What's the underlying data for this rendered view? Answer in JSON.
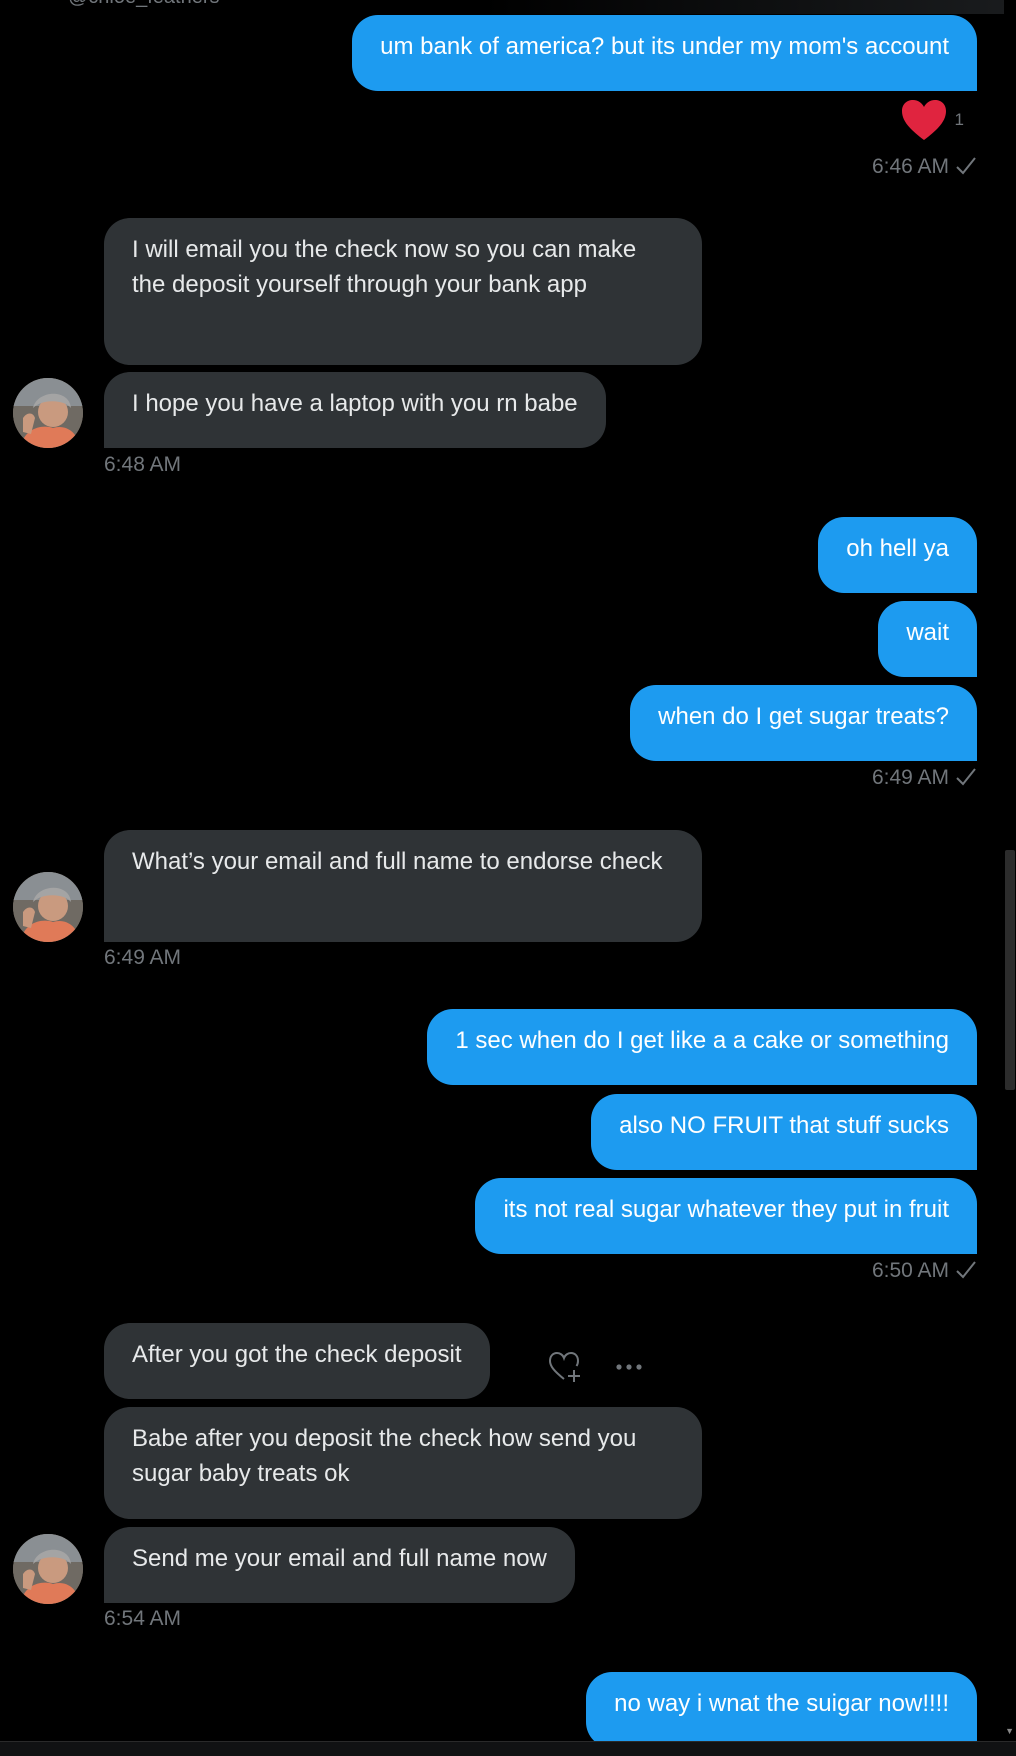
{
  "header": {
    "handle": "@chloe_feathers"
  },
  "messages": {
    "m1": {
      "text": "um bank of america? but its under my mom's account"
    },
    "m1_reaction_count": "1",
    "t1": "6:46 AM",
    "m2": {
      "text": "I will email you the check now so you can make the deposit yourself through your bank app"
    },
    "m3": {
      "text": "I hope you have a laptop with you rn babe"
    },
    "t2": "6:48 AM",
    "m4": {
      "text": "oh hell ya"
    },
    "m5": {
      "text": "wait"
    },
    "m6": {
      "text": "when do I get sugar treats?"
    },
    "t3": "6:49 AM",
    "m7": {
      "text": "What’s your email and full name to endorse check"
    },
    "t4": "6:49 AM",
    "m8": {
      "text": "1 sec when do I get like a a cake or something"
    },
    "m9": {
      "text": "also NO FRUIT that stuff sucks"
    },
    "m10": {
      "text": "its not real sugar whatever they put in fruit"
    },
    "t5": "6:50 AM",
    "m11": {
      "text": "After you got the check deposit"
    },
    "m12": {
      "text": "Babe after you deposit the check how send you sugar baby treats ok"
    },
    "m13": {
      "text": "Send me your email and full name now"
    },
    "t6": "6:54 AM",
    "m14": {
      "text": "no way i wnat the suigar now!!!!"
    }
  },
  "colors": {
    "background": "#000000",
    "outgoing_bubble": "#1d9bf0",
    "incoming_bubble": "#2f3336",
    "timestamp": "#71767b",
    "reaction_heart": "#f91880"
  },
  "icons": {
    "reaction": "heart-icon",
    "sent_status": "checkmark-icon",
    "add_reaction": "heart-plus-icon",
    "more": "more-dots-icon"
  }
}
